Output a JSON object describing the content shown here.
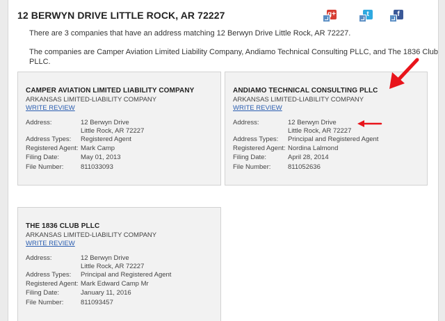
{
  "page": {
    "title": "12 BERWYN DRIVE LITTLE ROCK, AR 72227",
    "intro_1": "There are 3 companies that have an address matching 12 Berwyn Drive Little Rock, AR 72227.",
    "intro_2_line1": "The companies are Camper Aviation Limited Liability Company, Andiamo Technical Consulting PLLC, and The 1836 Club",
    "intro_2_line2": "PLLC."
  },
  "share": [
    {
      "icon": "google-plus-icon",
      "glyph": "g+",
      "color": "#d73d32"
    },
    {
      "icon": "twitter-icon",
      "glyph": "t",
      "color": "#2fa9e0"
    },
    {
      "icon": "facebook-icon",
      "glyph": "f",
      "color": "#3b5998"
    }
  ],
  "labels": {
    "address": "Address:",
    "types": "Address Types:",
    "agent": "Registered Agent:",
    "date": "Filing Date:",
    "number": "File Number:",
    "write_review": "WRITE REVIEW"
  },
  "companies": [
    {
      "name": "CAMPER AVIATION LIMITED LIABILITY COMPANY",
      "type": "ARKANSAS LIMITED-LIABILITY COMPANY",
      "address_line1": "12 Berwyn Drive",
      "address_line2": "Little Rock, AR 72227",
      "address_types": "Registered Agent",
      "registered_agent": "Mark Camp",
      "filing_date": "May 01, 2013",
      "file_number": "811033093"
    },
    {
      "name": "ANDIAMO TECHNICAL CONSULTING PLLC",
      "type": "ARKANSAS LIMITED-LIABILITY COMPANY",
      "address_line1": "12 Berwyn Drive",
      "address_line2": "Little Rock, AR 72227",
      "address_types": "Principal and Registered Agent",
      "registered_agent": "Nordina Lalmond",
      "filing_date": "April 28, 2014",
      "file_number": "811052636"
    },
    {
      "name": "THE 1836 CLUB PLLC",
      "type": "ARKANSAS LIMITED-LIABILITY COMPANY",
      "address_line1": "12 Berwyn Drive",
      "address_line2": "Little Rock, AR 72227",
      "address_types": "Principal and Registered Agent",
      "registered_agent": "Mark Edward Camp Mr",
      "filing_date": "January 11, 2016",
      "file_number": "811093457"
    }
  ],
  "annotation_color": "#e8141b"
}
